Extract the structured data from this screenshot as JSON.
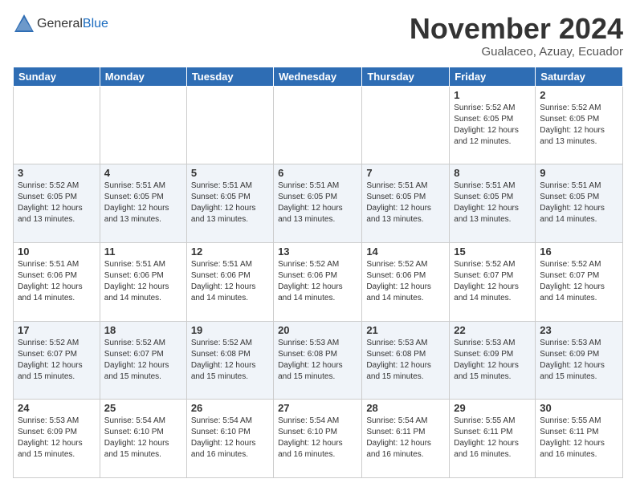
{
  "header": {
    "logo_general": "General",
    "logo_blue": "Blue",
    "month_title": "November 2024",
    "subtitle": "Gualaceo, Azuay, Ecuador"
  },
  "calendar": {
    "days_of_week": [
      "Sunday",
      "Monday",
      "Tuesday",
      "Wednesday",
      "Thursday",
      "Friday",
      "Saturday"
    ],
    "weeks": [
      [
        {
          "day": "",
          "info": ""
        },
        {
          "day": "",
          "info": ""
        },
        {
          "day": "",
          "info": ""
        },
        {
          "day": "",
          "info": ""
        },
        {
          "day": "",
          "info": ""
        },
        {
          "day": "1",
          "info": "Sunrise: 5:52 AM\nSunset: 6:05 PM\nDaylight: 12 hours\nand 12 minutes."
        },
        {
          "day": "2",
          "info": "Sunrise: 5:52 AM\nSunset: 6:05 PM\nDaylight: 12 hours\nand 13 minutes."
        }
      ],
      [
        {
          "day": "3",
          "info": "Sunrise: 5:52 AM\nSunset: 6:05 PM\nDaylight: 12 hours\nand 13 minutes."
        },
        {
          "day": "4",
          "info": "Sunrise: 5:51 AM\nSunset: 6:05 PM\nDaylight: 12 hours\nand 13 minutes."
        },
        {
          "day": "5",
          "info": "Sunrise: 5:51 AM\nSunset: 6:05 PM\nDaylight: 12 hours\nand 13 minutes."
        },
        {
          "day": "6",
          "info": "Sunrise: 5:51 AM\nSunset: 6:05 PM\nDaylight: 12 hours\nand 13 minutes."
        },
        {
          "day": "7",
          "info": "Sunrise: 5:51 AM\nSunset: 6:05 PM\nDaylight: 12 hours\nand 13 minutes."
        },
        {
          "day": "8",
          "info": "Sunrise: 5:51 AM\nSunset: 6:05 PM\nDaylight: 12 hours\nand 13 minutes."
        },
        {
          "day": "9",
          "info": "Sunrise: 5:51 AM\nSunset: 6:05 PM\nDaylight: 12 hours\nand 14 minutes."
        }
      ],
      [
        {
          "day": "10",
          "info": "Sunrise: 5:51 AM\nSunset: 6:06 PM\nDaylight: 12 hours\nand 14 minutes."
        },
        {
          "day": "11",
          "info": "Sunrise: 5:51 AM\nSunset: 6:06 PM\nDaylight: 12 hours\nand 14 minutes."
        },
        {
          "day": "12",
          "info": "Sunrise: 5:51 AM\nSunset: 6:06 PM\nDaylight: 12 hours\nand 14 minutes."
        },
        {
          "day": "13",
          "info": "Sunrise: 5:52 AM\nSunset: 6:06 PM\nDaylight: 12 hours\nand 14 minutes."
        },
        {
          "day": "14",
          "info": "Sunrise: 5:52 AM\nSunset: 6:06 PM\nDaylight: 12 hours\nand 14 minutes."
        },
        {
          "day": "15",
          "info": "Sunrise: 5:52 AM\nSunset: 6:07 PM\nDaylight: 12 hours\nand 14 minutes."
        },
        {
          "day": "16",
          "info": "Sunrise: 5:52 AM\nSunset: 6:07 PM\nDaylight: 12 hours\nand 14 minutes."
        }
      ],
      [
        {
          "day": "17",
          "info": "Sunrise: 5:52 AM\nSunset: 6:07 PM\nDaylight: 12 hours\nand 15 minutes."
        },
        {
          "day": "18",
          "info": "Sunrise: 5:52 AM\nSunset: 6:07 PM\nDaylight: 12 hours\nand 15 minutes."
        },
        {
          "day": "19",
          "info": "Sunrise: 5:52 AM\nSunset: 6:08 PM\nDaylight: 12 hours\nand 15 minutes."
        },
        {
          "day": "20",
          "info": "Sunrise: 5:53 AM\nSunset: 6:08 PM\nDaylight: 12 hours\nand 15 minutes."
        },
        {
          "day": "21",
          "info": "Sunrise: 5:53 AM\nSunset: 6:08 PM\nDaylight: 12 hours\nand 15 minutes."
        },
        {
          "day": "22",
          "info": "Sunrise: 5:53 AM\nSunset: 6:09 PM\nDaylight: 12 hours\nand 15 minutes."
        },
        {
          "day": "23",
          "info": "Sunrise: 5:53 AM\nSunset: 6:09 PM\nDaylight: 12 hours\nand 15 minutes."
        }
      ],
      [
        {
          "day": "24",
          "info": "Sunrise: 5:53 AM\nSunset: 6:09 PM\nDaylight: 12 hours\nand 15 minutes."
        },
        {
          "day": "25",
          "info": "Sunrise: 5:54 AM\nSunset: 6:10 PM\nDaylight: 12 hours\nand 15 minutes."
        },
        {
          "day": "26",
          "info": "Sunrise: 5:54 AM\nSunset: 6:10 PM\nDaylight: 12 hours\nand 16 minutes."
        },
        {
          "day": "27",
          "info": "Sunrise: 5:54 AM\nSunset: 6:10 PM\nDaylight: 12 hours\nand 16 minutes."
        },
        {
          "day": "28",
          "info": "Sunrise: 5:54 AM\nSunset: 6:11 PM\nDaylight: 12 hours\nand 16 minutes."
        },
        {
          "day": "29",
          "info": "Sunrise: 5:55 AM\nSunset: 6:11 PM\nDaylight: 12 hours\nand 16 minutes."
        },
        {
          "day": "30",
          "info": "Sunrise: 5:55 AM\nSunset: 6:11 PM\nDaylight: 12 hours\nand 16 minutes."
        }
      ]
    ]
  }
}
